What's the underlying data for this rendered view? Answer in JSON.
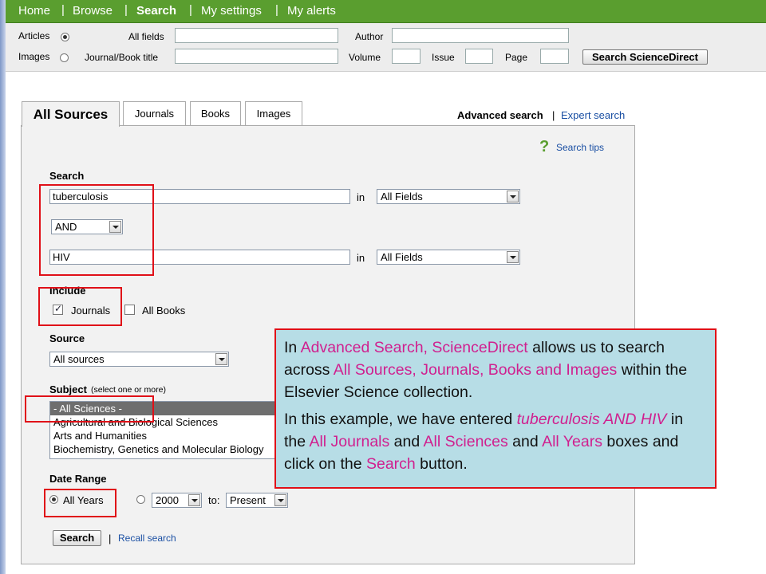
{
  "nav": {
    "items": [
      "Home",
      "Browse",
      "Search",
      "My settings",
      "My alerts"
    ]
  },
  "quick_search": {
    "articles_label": "Articles",
    "images_label": "Images",
    "all_fields_label": "All fields",
    "journal_title_label": "Journal/Book title",
    "author_label": "Author",
    "volume_label": "Volume",
    "issue_label": "Issue",
    "page_label": "Page",
    "search_button": "Search ScienceDirect"
  },
  "tabs": [
    "All Sources",
    "Journals",
    "Books",
    "Images"
  ],
  "header_links": {
    "advanced": "Advanced search",
    "separator": "|",
    "expert": "Expert search"
  },
  "search_tips": "Search tips",
  "form": {
    "search_label": "Search",
    "term1": "tuberculosis",
    "in1": "in",
    "field1": "All Fields",
    "operator": "AND",
    "term2": "HIV",
    "in2": "in",
    "field2": "All Fields",
    "include_label": "Include",
    "include_journals": "Journals",
    "include_books": "All Books",
    "source_label": "Source",
    "source_value": "All sources",
    "subject_label": "Subject",
    "subject_hint": "(select one or more)",
    "subjects": [
      "- All Sciences -",
      "Agricultural and Biological Sciences",
      "Arts and Humanities",
      "Biochemistry, Genetics and Molecular Biology"
    ],
    "date_label": "Date Range",
    "all_years": "All Years",
    "from_year": "2000",
    "to_label": "to:",
    "to_value": "Present",
    "search_button": "Search",
    "separator": "|",
    "recall": "Recall search"
  },
  "callout": {
    "p1": [
      "In ",
      "Advanced Search, ScienceDirect",
      " allows us to search across ",
      "All Sources, Journals, Books and Images",
      " within the Elsevier Science collection."
    ],
    "p2": [
      "In this example, we have  entered ",
      "tuberculosis AND HIV",
      " in the ",
      "All Journals",
      " and ",
      "All Sciences",
      " and ",
      "All Years",
      " boxes and click on the ",
      "Search",
      " button."
    ]
  },
  "colors": {
    "nav_green": "#5a9e2f",
    "highlight_red": "#e01018",
    "callout_bg": "#b7dde6",
    "callout_emphasis": "#d0208f",
    "link_blue": "#1a4fa3"
  }
}
